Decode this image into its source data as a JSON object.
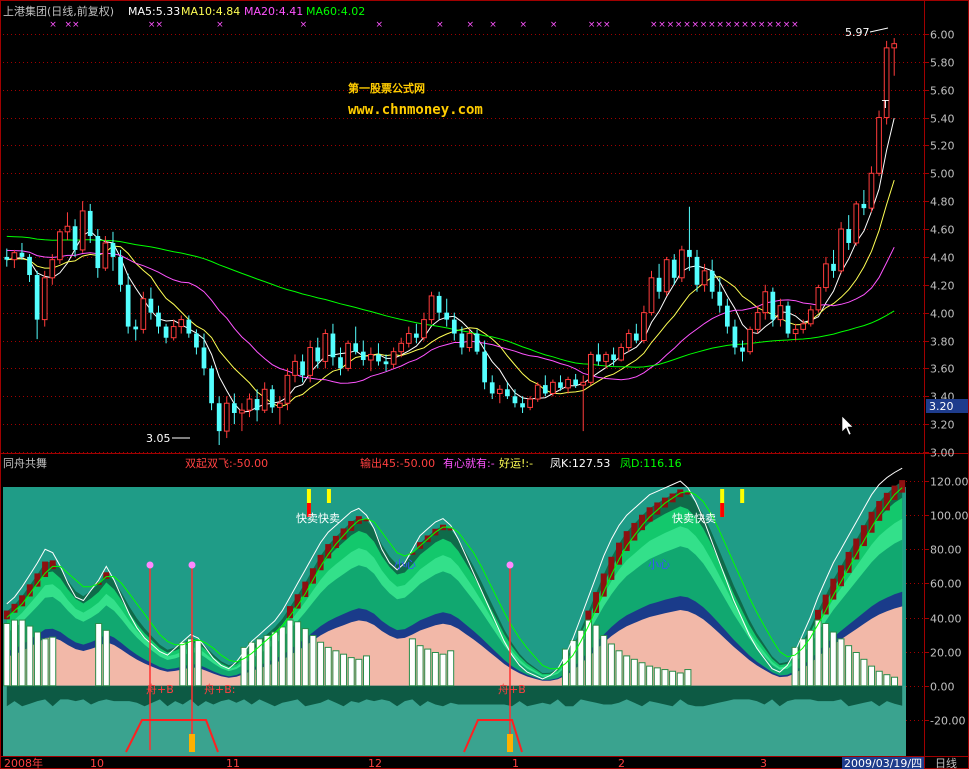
{
  "header": {
    "title": "上港集团(日线,前复权)",
    "ma5": "MA5:5.33",
    "ma10": "MA10:4.84",
    "ma20": "MA20:4.41",
    "ma60": "MA60:4.02"
  },
  "watermark": {
    "line1": "第一股票公式网",
    "line2": "www.chnmoney.com"
  },
  "annotations": {
    "low": "3.05",
    "high": "5.97",
    "t_mark": "T",
    "price_tag": "3.20"
  },
  "indicator": {
    "name": "同舟共舞",
    "v1": "双起双飞:-50.00",
    "v2": "输出45:-50.00",
    "v3": "有心就有:-",
    "v4": "好运!:-",
    "k": "凤K:127.53",
    "d": "凤D:116.16",
    "sell_label_1": "快卖快卖",
    "sell_label_2": "快卖快卖",
    "small_heart_1": "小心",
    "small_heart_2": "小心",
    "zhou_b_1": "舟+B",
    "zhou_b_2": "舟+B:",
    "zhou_b_3": "舟+B"
  },
  "xaxis": {
    "labels": [
      "2008年",
      "10",
      "11",
      "12",
      "1",
      "2",
      "3",
      "2009/03/19/四"
    ],
    "period": "日线"
  },
  "colors": {
    "bull": "#ff3c3c",
    "bear": "#54ffff",
    "ma5": "#ffffff",
    "ma10": "#ffff54",
    "ma20": "#ff54ff",
    "ma60": "#00ff00",
    "grid": "#a00000",
    "axis_text": "#c0c0c0",
    "watermark": "#ffcc00"
  },
  "chart_data": [
    {
      "type": "candlestick",
      "title": "上港集团(日线,前复权)",
      "ylim": [
        3.0,
        6.1
      ],
      "yticks": [
        3.0,
        3.2,
        3.4,
        3.6,
        3.8,
        4.0,
        4.2,
        4.4,
        4.6,
        4.8,
        5.0,
        5.2,
        5.4,
        5.6,
        5.8,
        6.0
      ],
      "period_marks": [
        "2008年",
        "10",
        "11",
        "12",
        "1",
        "2",
        "3"
      ],
      "end_date": "2009/03/19/四",
      "ohlc": [
        [
          4.4,
          4.46,
          4.33,
          4.38
        ],
        [
          4.38,
          4.45,
          4.32,
          4.43
        ],
        [
          4.43,
          4.5,
          4.38,
          4.4
        ],
        [
          4.4,
          4.42,
          4.22,
          4.27
        ],
        [
          4.27,
          4.3,
          3.81,
          3.95
        ],
        [
          3.95,
          4.3,
          3.9,
          4.25
        ],
        [
          4.25,
          4.42,
          4.2,
          4.38
        ],
        [
          4.38,
          4.6,
          4.35,
          4.58
        ],
        [
          4.58,
          4.72,
          4.52,
          4.62
        ],
        [
          4.62,
          4.67,
          4.4,
          4.45
        ],
        [
          4.45,
          4.8,
          4.43,
          4.73
        ],
        [
          4.73,
          4.78,
          4.5,
          4.55
        ],
        [
          4.55,
          4.6,
          4.25,
          4.32
        ],
        [
          4.32,
          4.55,
          4.3,
          4.5
        ],
        [
          4.5,
          4.58,
          4.3,
          4.4
        ],
        [
          4.4,
          4.45,
          4.15,
          4.2
        ],
        [
          4.2,
          4.28,
          3.85,
          3.9
        ],
        [
          3.9,
          3.95,
          3.8,
          3.88
        ],
        [
          3.88,
          4.15,
          3.85,
          4.1
        ],
        [
          4.1,
          4.18,
          3.95,
          4.0
        ],
        [
          4.0,
          4.05,
          3.85,
          3.9
        ],
        [
          3.9,
          3.92,
          3.78,
          3.82
        ],
        [
          3.82,
          3.95,
          3.8,
          3.9
        ],
        [
          3.9,
          3.98,
          3.85,
          3.95
        ],
        [
          3.95,
          3.98,
          3.82,
          3.85
        ],
        [
          3.85,
          3.88,
          3.7,
          3.75
        ],
        [
          3.75,
          3.85,
          3.55,
          3.6
        ],
        [
          3.6,
          3.62,
          3.3,
          3.35
        ],
        [
          3.35,
          3.4,
          3.05,
          3.15
        ],
        [
          3.15,
          3.4,
          3.1,
          3.35
        ],
        [
          3.35,
          3.42,
          3.2,
          3.28
        ],
        [
          3.28,
          3.35,
          3.15,
          3.3
        ],
        [
          3.3,
          3.42,
          3.25,
          3.38
        ],
        [
          3.38,
          3.45,
          3.22,
          3.3
        ],
        [
          3.3,
          3.5,
          3.28,
          3.45
        ],
        [
          3.45,
          3.48,
          3.28,
          3.32
        ],
        [
          3.32,
          3.4,
          3.2,
          3.35
        ],
        [
          3.35,
          3.6,
          3.3,
          3.55
        ],
        [
          3.55,
          3.7,
          3.5,
          3.65
        ],
        [
          3.65,
          3.7,
          3.5,
          3.55
        ],
        [
          3.55,
          3.8,
          3.5,
          3.75
        ],
        [
          3.75,
          3.82,
          3.6,
          3.65
        ],
        [
          3.65,
          3.88,
          3.6,
          3.85
        ],
        [
          3.85,
          3.92,
          3.62,
          3.68
        ],
        [
          3.68,
          3.75,
          3.55,
          3.6
        ],
        [
          3.6,
          3.8,
          3.58,
          3.78
        ],
        [
          3.78,
          3.9,
          3.7,
          3.72
        ],
        [
          3.72,
          3.8,
          3.62,
          3.66
        ],
        [
          3.66,
          3.75,
          3.58,
          3.7
        ],
        [
          3.7,
          3.78,
          3.62,
          3.65
        ],
        [
          3.65,
          3.7,
          3.58,
          3.63
        ],
        [
          3.63,
          3.75,
          3.6,
          3.72
        ],
        [
          3.72,
          3.82,
          3.68,
          3.78
        ],
        [
          3.78,
          3.9,
          3.75,
          3.85
        ],
        [
          3.85,
          3.92,
          3.78,
          3.82
        ],
        [
          3.82,
          4.0,
          3.8,
          3.95
        ],
        [
          3.95,
          4.15,
          3.92,
          4.12
        ],
        [
          4.12,
          4.15,
          3.95,
          4.0
        ],
        [
          4.0,
          4.1,
          3.9,
          3.95
        ],
        [
          3.95,
          4.0,
          3.8,
          3.85
        ],
        [
          3.85,
          3.9,
          3.7,
          3.75
        ],
        [
          3.75,
          3.88,
          3.72,
          3.85
        ],
        [
          3.85,
          3.88,
          3.7,
          3.72
        ],
        [
          3.72,
          3.8,
          3.45,
          3.5
        ],
        [
          3.5,
          3.55,
          3.38,
          3.42
        ],
        [
          3.42,
          3.48,
          3.35,
          3.45
        ],
        [
          3.45,
          3.5,
          3.38,
          3.4
        ],
        [
          3.4,
          3.45,
          3.32,
          3.35
        ],
        [
          3.35,
          3.4,
          3.28,
          3.32
        ],
        [
          3.32,
          3.4,
          3.3,
          3.38
        ],
        [
          3.38,
          3.5,
          3.36,
          3.48
        ],
        [
          3.48,
          3.55,
          3.4,
          3.42
        ],
        [
          3.42,
          3.52,
          3.4,
          3.5
        ],
        [
          3.5,
          3.55,
          3.44,
          3.46
        ],
        [
          3.46,
          3.54,
          3.42,
          3.52
        ],
        [
          3.52,
          3.56,
          3.46,
          3.48
        ],
        [
          3.48,
          3.55,
          3.15,
          3.5
        ],
        [
          3.5,
          3.72,
          3.48,
          3.7
        ],
        [
          3.7,
          3.78,
          3.62,
          3.65
        ],
        [
          3.65,
          3.72,
          3.6,
          3.7
        ],
        [
          3.7,
          3.75,
          3.62,
          3.66
        ],
        [
          3.66,
          3.78,
          3.65,
          3.75
        ],
        [
          3.75,
          3.88,
          3.72,
          3.85
        ],
        [
          3.85,
          3.92,
          3.78,
          3.8
        ],
        [
          3.8,
          4.05,
          3.78,
          4.0
        ],
        [
          4.0,
          4.3,
          3.98,
          4.25
        ],
        [
          4.25,
          4.35,
          4.1,
          4.15
        ],
        [
          4.15,
          4.4,
          4.12,
          4.38
        ],
        [
          4.38,
          4.42,
          4.2,
          4.25
        ],
        [
          4.25,
          4.48,
          4.22,
          4.45
        ],
        [
          4.45,
          4.76,
          4.3,
          4.4
        ],
        [
          4.4,
          4.45,
          4.15,
          4.2
        ],
        [
          4.2,
          4.35,
          4.15,
          4.3
        ],
        [
          4.3,
          4.38,
          4.1,
          4.15
        ],
        [
          4.15,
          4.25,
          4.0,
          4.05
        ],
        [
          4.05,
          4.1,
          3.85,
          3.9
        ],
        [
          3.9,
          3.95,
          3.7,
          3.75
        ],
        [
          3.75,
          3.8,
          3.65,
          3.72
        ],
        [
          3.72,
          3.9,
          3.7,
          3.88
        ],
        [
          3.88,
          4.05,
          3.85,
          4.0
        ],
        [
          4.0,
          4.2,
          3.95,
          4.15
        ],
        [
          4.15,
          4.18,
          3.9,
          3.95
        ],
        [
          3.95,
          4.1,
          3.9,
          4.05
        ],
        [
          4.05,
          4.08,
          3.82,
          3.85
        ],
        [
          3.85,
          3.92,
          3.8,
          3.88
        ],
        [
          3.88,
          3.95,
          3.85,
          3.92
        ],
        [
          3.92,
          4.05,
          3.9,
          4.02
        ],
        [
          4.02,
          4.2,
          4.0,
          4.18
        ],
        [
          4.18,
          4.4,
          4.15,
          4.35
        ],
        [
          4.35,
          4.45,
          4.25,
          4.3
        ],
        [
          4.3,
          4.65,
          4.28,
          4.6
        ],
        [
          4.6,
          4.7,
          4.45,
          4.5
        ],
        [
          4.5,
          4.8,
          4.48,
          4.78
        ],
        [
          4.78,
          4.88,
          4.7,
          4.75
        ],
        [
          4.75,
          5.05,
          4.72,
          5.0
        ],
        [
          5.0,
          5.45,
          4.98,
          5.4
        ],
        [
          5.4,
          5.95,
          5.35,
          5.9
        ],
        [
          5.9,
          5.97,
          5.7,
          5.93
        ]
      ],
      "moving_averages": [
        {
          "name": "MA5",
          "period": 5
        },
        {
          "name": "MA10",
          "period": 10
        },
        {
          "name": "MA20",
          "period": 20
        },
        {
          "name": "MA60",
          "period": 60
        }
      ]
    },
    {
      "type": "area",
      "title": "同舟共舞",
      "ylim": [
        -40,
        130
      ],
      "yticks": [
        -20,
        0,
        20,
        40,
        60,
        80,
        100,
        120
      ],
      "series": [
        {
          "name": "凤K",
          "last": 127.53
        },
        {
          "name": "凤D",
          "last": 116.16
        }
      ],
      "k": [
        48,
        52,
        58,
        65,
        72,
        80,
        78,
        70,
        60,
        52,
        50,
        56,
        62,
        70,
        62,
        52,
        42,
        34,
        28,
        24,
        20,
        18,
        22,
        26,
        30,
        28,
        22,
        16,
        12,
        10,
        14,
        20,
        26,
        30,
        34,
        38,
        44,
        52,
        60,
        68,
        76,
        84,
        90,
        94,
        98,
        102,
        104,
        100,
        92,
        80,
        72,
        68,
        72,
        80,
        88,
        92,
        96,
        98,
        94,
        86,
        76,
        66,
        56,
        46,
        36,
        26,
        18,
        12,
        8,
        6,
        4,
        6,
        10,
        18,
        28,
        40,
        52,
        64,
        76,
        86,
        94,
        100,
        104,
        108,
        112,
        114,
        116,
        118,
        120,
        116,
        108,
        98,
        86,
        74,
        62,
        50,
        40,
        30,
        22,
        16,
        10,
        8,
        12,
        20,
        30,
        40,
        52,
        62,
        72,
        80,
        88,
        96,
        104,
        112,
        118,
        122,
        125,
        127.53
      ],
      "d": [
        40,
        44,
        48,
        54,
        60,
        66,
        70,
        70,
        66,
        62,
        58,
        58,
        60,
        64,
        64,
        60,
        54,
        48,
        42,
        36,
        30,
        26,
        24,
        24,
        26,
        27,
        25,
        22,
        18,
        15,
        14,
        16,
        19,
        23,
        27,
        31,
        35,
        41,
        47,
        54,
        62,
        70,
        77,
        83,
        88,
        93,
        97,
        98,
        96,
        90,
        84,
        78,
        76,
        78,
        82,
        86,
        90,
        93,
        93,
        90,
        84,
        78,
        70,
        61,
        52,
        43,
        35,
        28,
        22,
        17,
        12,
        10,
        10,
        13,
        18,
        26,
        35,
        45,
        55,
        65,
        74,
        82,
        88,
        94,
        99,
        103,
        107,
        110,
        113,
        114,
        112,
        108,
        101,
        92,
        82,
        72,
        62,
        52,
        43,
        35,
        27,
        20,
        17,
        18,
        22,
        28,
        36,
        44,
        53,
        61,
        69,
        77,
        85,
        93,
        100,
        106,
        112,
        116.16
      ],
      "sell_points": [
        40,
        94
      ]
    }
  ]
}
